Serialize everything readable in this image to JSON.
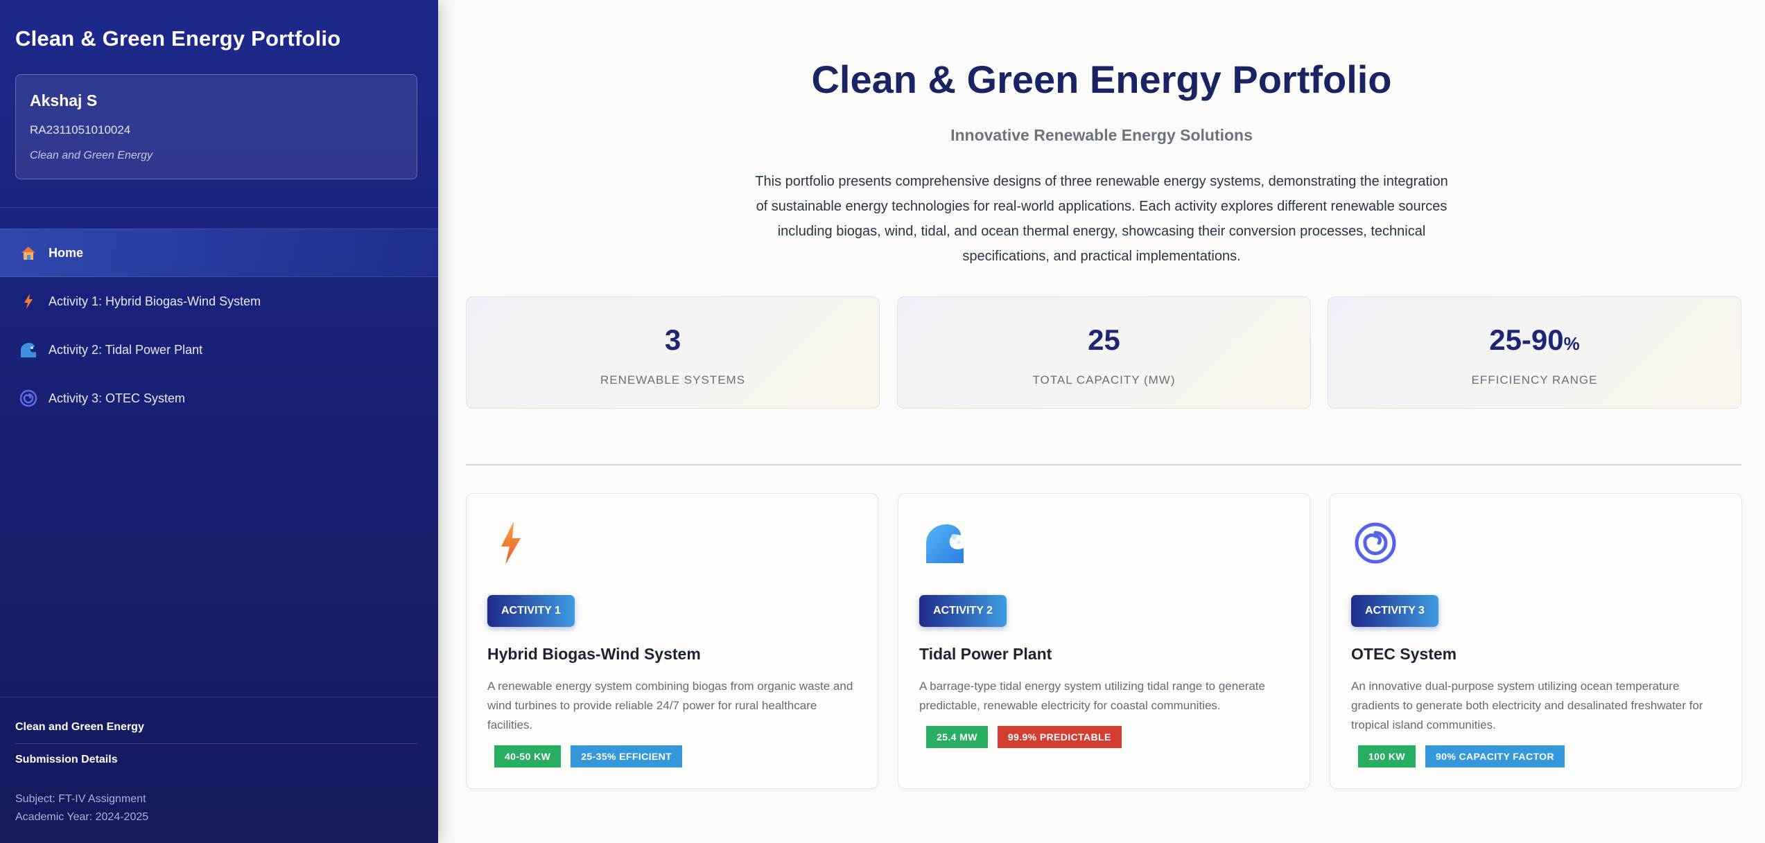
{
  "sidebar": {
    "title": "Clean & Green Energy Portfolio",
    "profile": {
      "name": "Akshaj S",
      "id": "RA2311051010024",
      "subject": "Clean and Green Energy"
    },
    "nav": [
      {
        "label": "Home",
        "icon": "house-icon",
        "active": true
      },
      {
        "label": "Activity 1: Hybrid Biogas-Wind System",
        "icon": "lightning-icon",
        "active": false
      },
      {
        "label": "Activity 2: Tidal Power Plant",
        "icon": "wave-icon",
        "active": false
      },
      {
        "label": "Activity 3: OTEC System",
        "icon": "spiral-icon",
        "active": false
      }
    ],
    "footer": {
      "course": "Clean and Green Energy",
      "section": "Submission Details",
      "subject_line": "Subject: FT-IV Assignment",
      "year_line": "Academic Year: 2024-2025"
    }
  },
  "hero": {
    "title": "Clean & Green Energy Portfolio",
    "subtitle": "Innovative Renewable Energy Solutions",
    "description": "This portfolio presents comprehensive designs of three renewable energy systems, demonstrating the integration of sustainable energy technologies for real-world applications. Each activity explores different renewable sources including biogas, wind, tidal, and ocean thermal energy, showcasing their conversion processes, technical specifications, and practical implementations."
  },
  "stats": [
    {
      "value": "3",
      "suffix": "",
      "label": "RENEWABLE SYSTEMS"
    },
    {
      "value": "25",
      "suffix": "",
      "label": "TOTAL CAPACITY (MW)"
    },
    {
      "value": "25-90",
      "suffix": "%",
      "label": "EFFICIENCY RANGE"
    }
  ],
  "cards": [
    {
      "icon": "lightning-icon",
      "badge": "ACTIVITY 1",
      "title": "Hybrid Biogas-Wind System",
      "description": "A renewable energy system combining biogas from organic waste and wind turbines to provide reliable 24/7 power for rural healthcare facilities.",
      "tags": [
        {
          "label": "40-50 KW",
          "color": "#27ae60"
        },
        {
          "label": "25-35% EFFICIENT",
          "color": "#3498db"
        }
      ]
    },
    {
      "icon": "wave-icon",
      "badge": "ACTIVITY 2",
      "title": "Tidal Power Plant",
      "description": "A barrage-type tidal energy system utilizing tidal range to generate predictable, renewable electricity for coastal communities.",
      "tags": [
        {
          "label": "25.4 MW",
          "color": "#27ae60"
        },
        {
          "label": "99.9% PREDICTABLE",
          "color": "#d23f32"
        }
      ]
    },
    {
      "icon": "spiral-icon",
      "badge": "ACTIVITY 3",
      "title": "OTEC System",
      "description": "An innovative dual-purpose system utilizing ocean temperature gradients to generate both electricity and desalinated freshwater for tropical island communities.",
      "tags": [
        {
          "label": "100 KW",
          "color": "#27ae60"
        },
        {
          "label": "90% CAPACITY FACTOR",
          "color": "#3498db"
        }
      ]
    }
  ]
}
